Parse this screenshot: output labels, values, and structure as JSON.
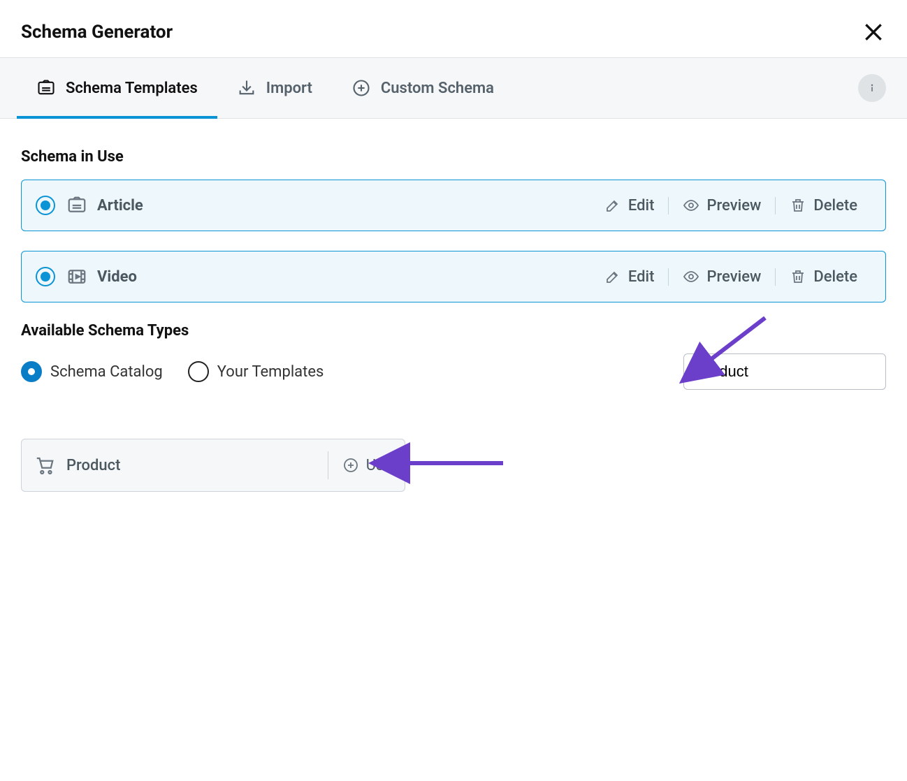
{
  "header": {
    "title": "Schema Generator"
  },
  "tabs": {
    "templates": "Schema Templates",
    "import": "Import",
    "custom": "Custom Schema"
  },
  "sections": {
    "in_use_title": "Schema in Use",
    "available_title": "Available Schema Types"
  },
  "schema_in_use": [
    {
      "name": "Article"
    },
    {
      "name": "Video"
    }
  ],
  "row_actions": {
    "edit": "Edit",
    "preview": "Preview",
    "delete": "Delete"
  },
  "filters": {
    "catalog": "Schema Catalog",
    "your_templates": "Your Templates"
  },
  "search": {
    "value": "Product"
  },
  "result": {
    "name": "Product",
    "use_label": "Use"
  }
}
